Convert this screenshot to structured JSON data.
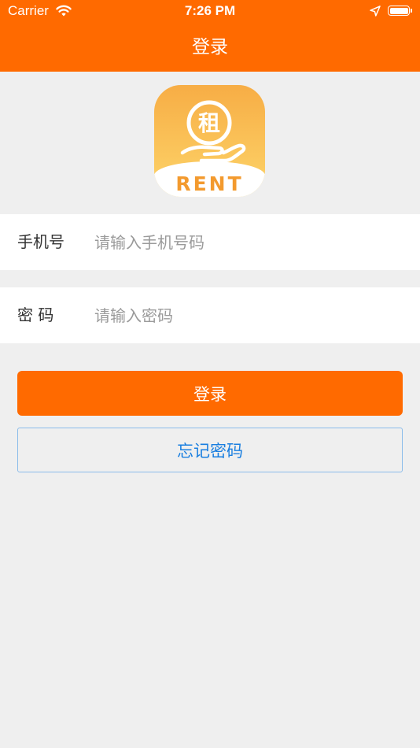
{
  "status_bar": {
    "carrier": "Carrier",
    "time": "7:26 PM",
    "icons": [
      "wifi-icon",
      "location-arrow-icon",
      "battery-icon"
    ]
  },
  "nav": {
    "title": "登录"
  },
  "logo": {
    "char": "租",
    "text": "RENT",
    "colors": {
      "top": "#f7ad45",
      "bottom": "#fdd56a",
      "text": "#f39a2e"
    }
  },
  "form": {
    "phone": {
      "label": "手机号",
      "placeholder": "请输入手机号码",
      "value": ""
    },
    "password": {
      "label": "密 码",
      "placeholder": "请输入密码",
      "value": ""
    }
  },
  "buttons": {
    "login": "登录",
    "forgot": "忘记密码"
  },
  "colors": {
    "accent": "#ff6a00",
    "background": "#efefef",
    "link": "#1a7fe0"
  }
}
